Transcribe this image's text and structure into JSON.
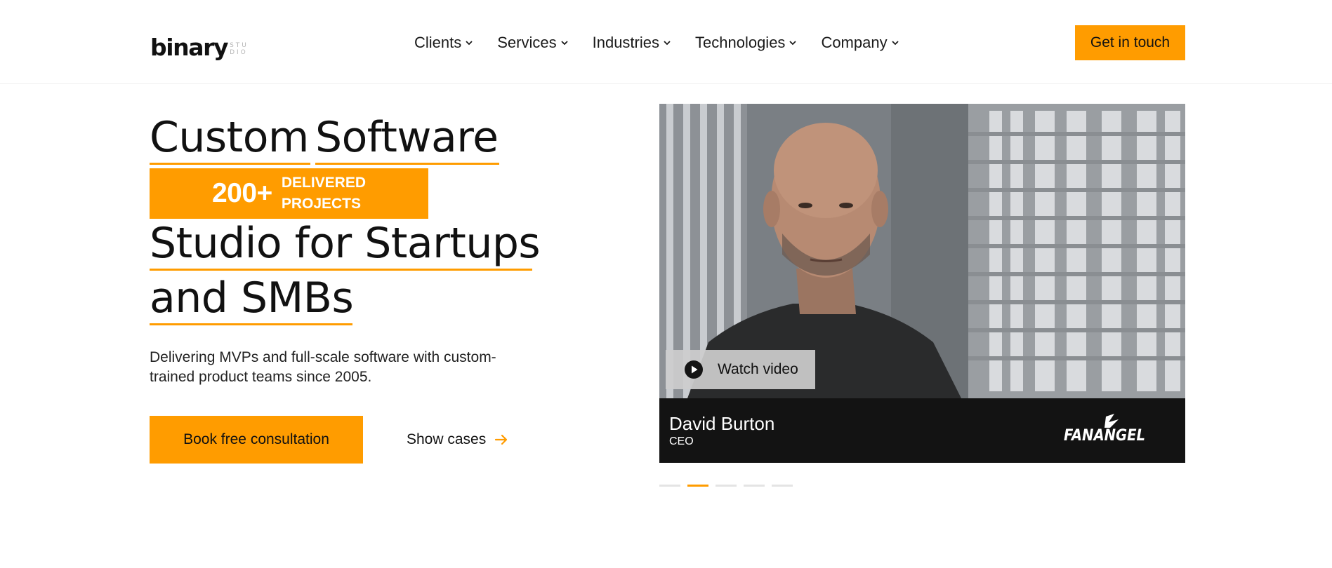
{
  "header": {
    "logo": {
      "word": "binary",
      "small_top": "STU",
      "small_bottom": "DIO"
    },
    "nav": [
      {
        "label": "Clients"
      },
      {
        "label": "Services"
      },
      {
        "label": "Industries"
      },
      {
        "label": "Technologies"
      },
      {
        "label": "Company"
      }
    ],
    "cta_label": "Get in touch"
  },
  "hero": {
    "title_words": [
      "Custom",
      "Software",
      "Studio for Startups",
      "and SMBs"
    ],
    "badge": {
      "number": "200+",
      "line1": "DELIVERED",
      "line2": "PROJECTS"
    },
    "subtitle": "Delivering MVPs and full-scale software with custom-trained product teams since 2005.",
    "primary_button": "Book free consultation",
    "secondary_link": "Show cases"
  },
  "video_card": {
    "watch_label": "Watch video",
    "person_name": "David Burton",
    "person_role": "CEO",
    "brand": "FANANGEL",
    "slides_total": 5,
    "active_slide": 2
  },
  "colors": {
    "accent": "#ff9c00",
    "text": "#111111",
    "caption_bg": "#131313",
    "dot_inactive": "#e4e4e4"
  },
  "icons": [
    "chevron-down-icon",
    "arrow-right-icon",
    "play-icon"
  ]
}
